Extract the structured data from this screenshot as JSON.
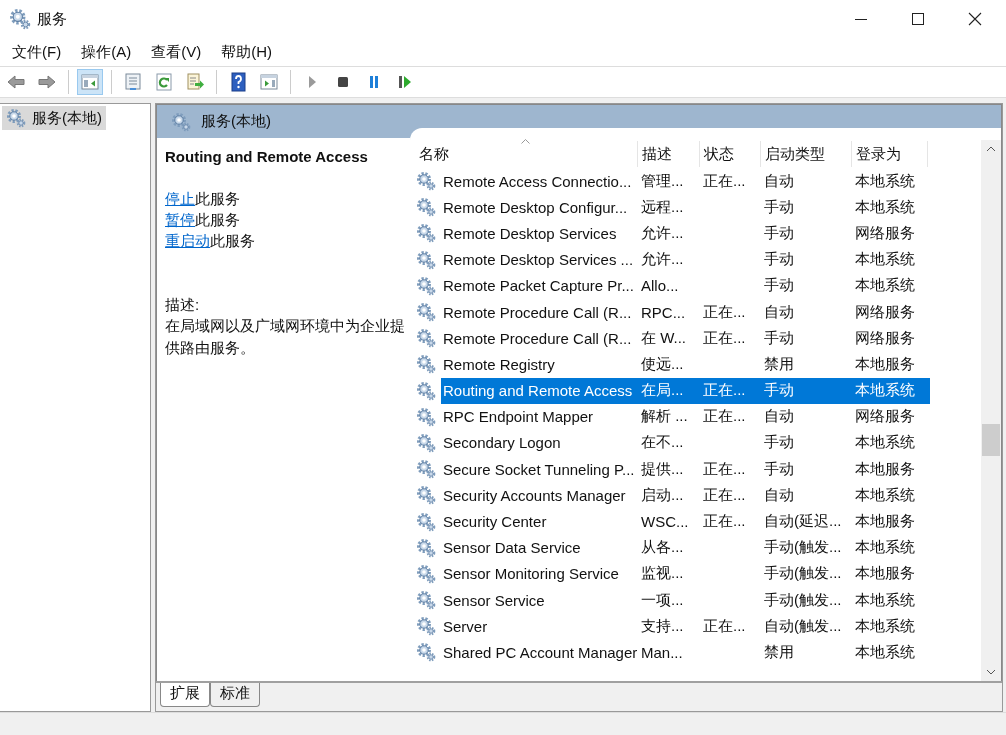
{
  "window": {
    "title": "服务"
  },
  "menu": [
    {
      "label": "文件(F)"
    },
    {
      "label": "操作(A)"
    },
    {
      "label": "查看(V)"
    },
    {
      "label": "帮助(H)"
    }
  ],
  "toolbar": [
    {
      "kind": "back",
      "selected": false
    },
    {
      "kind": "forward",
      "selected": false
    },
    {
      "kind": "sep"
    },
    {
      "kind": "tree",
      "selected": true
    },
    {
      "kind": "sep"
    },
    {
      "kind": "properties",
      "selected": false
    },
    {
      "kind": "refresh",
      "selected": false
    },
    {
      "kind": "export",
      "selected": false
    },
    {
      "kind": "sep"
    },
    {
      "kind": "help",
      "selected": false
    },
    {
      "kind": "actionpane",
      "selected": false
    },
    {
      "kind": "sep"
    },
    {
      "kind": "play",
      "selected": false
    },
    {
      "kind": "stop",
      "selected": false
    },
    {
      "kind": "pause",
      "selected": false
    },
    {
      "kind": "resume",
      "selected": false
    }
  ],
  "tree": {
    "items": [
      {
        "label": "服务(本地)",
        "selected": true
      }
    ]
  },
  "pane": {
    "title": "服务(本地)",
    "detail": {
      "name": "Routing and Remote Access",
      "actions": [
        {
          "link": "停止",
          "rest": "此服务"
        },
        {
          "link": "暂停",
          "rest": "此服务"
        },
        {
          "link": "重启动",
          "rest": "此服务"
        }
      ],
      "description_label": "描述:",
      "description": "在局域网以及广域网环境中为企业提供路由服务。"
    },
    "table": {
      "columns": [
        "名称",
        "描述",
        "状态",
        "启动类型",
        "登录为"
      ],
      "rows": [
        {
          "cells": [
            "Remote Access Connectio...",
            "管理...",
            "正在...",
            "自动",
            "本地系统"
          ],
          "selected": false
        },
        {
          "cells": [
            "Remote Desktop Configur...",
            "远程...",
            "",
            "手动",
            "本地系统"
          ],
          "selected": false
        },
        {
          "cells": [
            "Remote Desktop Services",
            "允许...",
            "",
            "手动",
            "网络服务"
          ],
          "selected": false
        },
        {
          "cells": [
            "Remote Desktop Services ...",
            "允许...",
            "",
            "手动",
            "本地系统"
          ],
          "selected": false
        },
        {
          "cells": [
            "Remote Packet Capture Pr...",
            "Allo...",
            "",
            "手动",
            "本地系统"
          ],
          "selected": false
        },
        {
          "cells": [
            "Remote Procedure Call (R...",
            "RPC...",
            "正在...",
            "自动",
            "网络服务"
          ],
          "selected": false
        },
        {
          "cells": [
            "Remote Procedure Call (R...",
            "在 W...",
            "正在...",
            "手动",
            "网络服务"
          ],
          "selected": false
        },
        {
          "cells": [
            "Remote Registry",
            "使远...",
            "",
            "禁用",
            "本地服务"
          ],
          "selected": false
        },
        {
          "cells": [
            "Routing and Remote Access",
            "在局...",
            "正在...",
            "手动",
            "本地系统"
          ],
          "selected": true
        },
        {
          "cells": [
            "RPC Endpoint Mapper",
            "解析 ...",
            "正在...",
            "自动",
            "网络服务"
          ],
          "selected": false
        },
        {
          "cells": [
            "Secondary Logon",
            "在不...",
            "",
            "手动",
            "本地系统"
          ],
          "selected": false
        },
        {
          "cells": [
            "Secure Socket Tunneling P...",
            "提供...",
            "正在...",
            "手动",
            "本地服务"
          ],
          "selected": false
        },
        {
          "cells": [
            "Security Accounts Manager",
            "启动...",
            "正在...",
            "自动",
            "本地系统"
          ],
          "selected": false
        },
        {
          "cells": [
            "Security Center",
            "WSC...",
            "正在...",
            "自动(延迟...",
            "本地服务"
          ],
          "selected": false
        },
        {
          "cells": [
            "Sensor Data Service",
            "从各...",
            "",
            "手动(触发...",
            "本地系统"
          ],
          "selected": false
        },
        {
          "cells": [
            "Sensor Monitoring Service",
            "监视...",
            "",
            "手动(触发...",
            "本地服务"
          ],
          "selected": false
        },
        {
          "cells": [
            "Sensor Service",
            "一项...",
            "",
            "手动(触发...",
            "本地系统"
          ],
          "selected": false
        },
        {
          "cells": [
            "Server",
            "支持...",
            "正在...",
            "自动(触发...",
            "本地系统"
          ],
          "selected": false
        },
        {
          "cells": [
            "Shared PC Account Manager",
            "Man...",
            "",
            "禁用",
            "本地系统"
          ],
          "selected": false
        }
      ]
    },
    "view_tabs": [
      {
        "label": "扩展",
        "selected": true
      },
      {
        "label": "标准",
        "selected": false
      }
    ]
  }
}
